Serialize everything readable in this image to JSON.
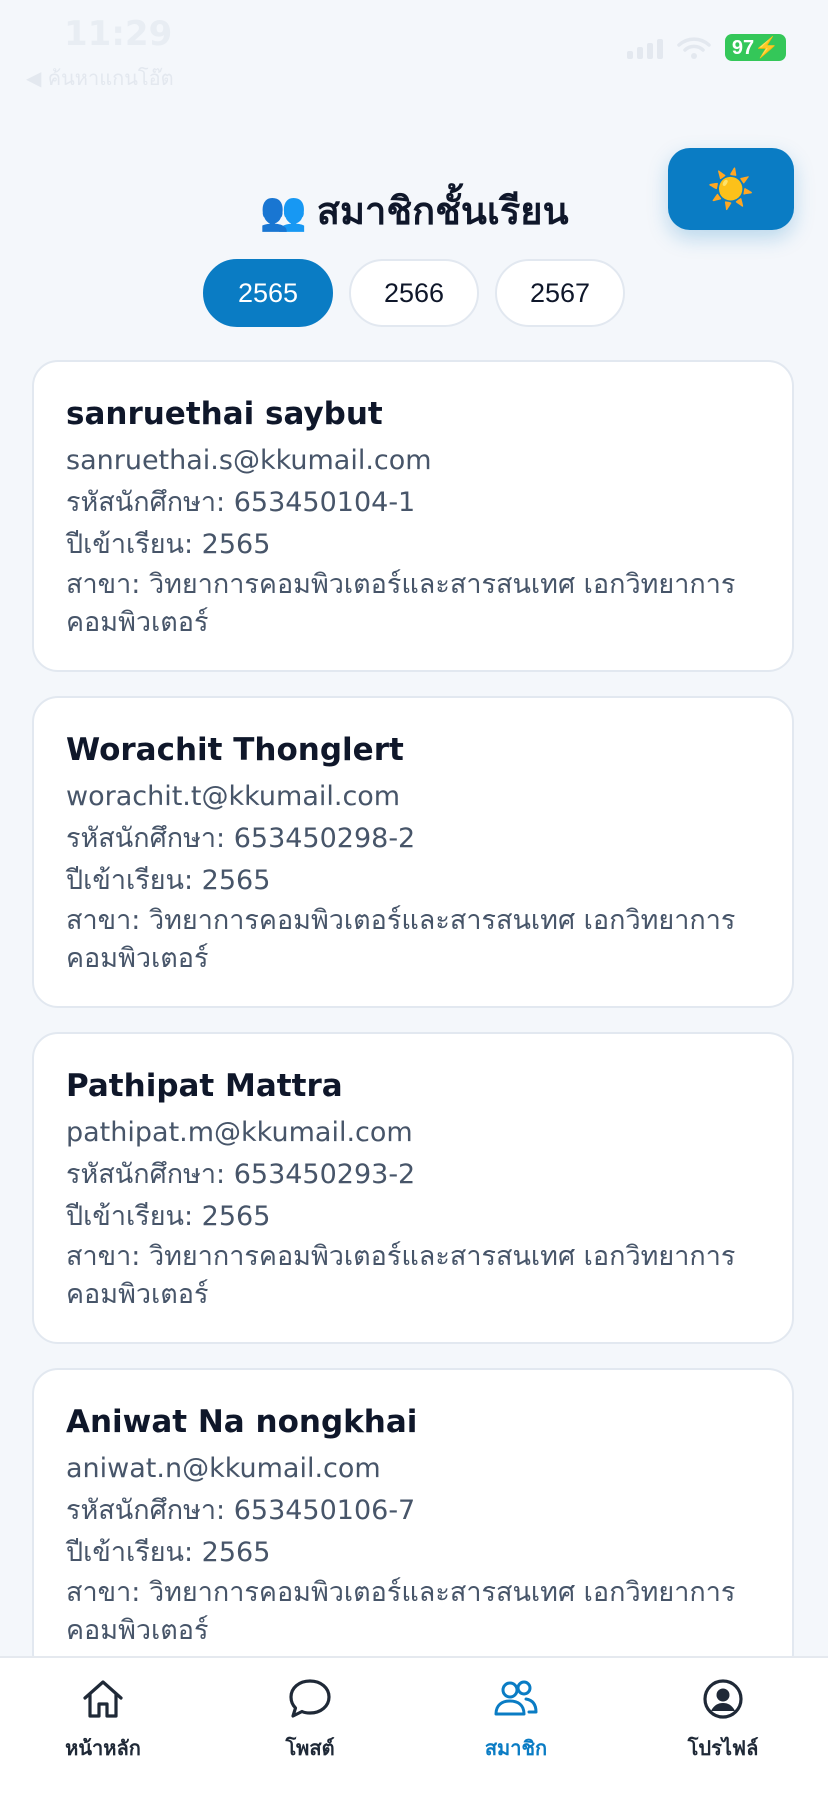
{
  "status_bar": {
    "time": "11:29",
    "back_app": "◀ ค้นหาแกนโอ๊ต",
    "battery": "97"
  },
  "header": {
    "title_icon": "👥",
    "title": "สมาชิกชั้นเรียน",
    "theme_toggle_icon": "☀️"
  },
  "year_tabs": [
    {
      "label": "2565",
      "active": true
    },
    {
      "label": "2566",
      "active": false
    },
    {
      "label": "2567",
      "active": false
    }
  ],
  "members": [
    {
      "name": "sanruethai saybut",
      "email": "sanruethai.s@kkumail.com",
      "student_id": "รหัสนักศึกษา: 653450104-1",
      "entry_year": "ปีเข้าเรียน: 2565",
      "major_line1": "สาขา: วิทยาการคอมพิวเตอร์และสารสนเทศ เอกวิทยาการ",
      "major_line2": "คอมพิวเตอร์"
    },
    {
      "name": "Worachit Thonglert",
      "email": "worachit.t@kkumail.com",
      "student_id": "รหัสนักศึกษา: 653450298-2",
      "entry_year": "ปีเข้าเรียน: 2565",
      "major_line1": "สาขา: วิทยาการคอมพิวเตอร์และสารสนเทศ เอกวิทยาการ",
      "major_line2": "คอมพิวเตอร์"
    },
    {
      "name": "Pathipat Mattra",
      "email": "pathipat.m@kkumail.com",
      "student_id": "รหัสนักศึกษา: 653450293-2",
      "entry_year": "ปีเข้าเรียน: 2565",
      "major_line1": "สาขา: วิทยาการคอมพิวเตอร์และสารสนเทศ เอกวิทยาการ",
      "major_line2": "คอมพิวเตอร์"
    },
    {
      "name": "Aniwat Na nongkhai",
      "email": "aniwat.n@kkumail.com",
      "student_id": "รหัสนักศึกษา: 653450106-7",
      "entry_year": "ปีเข้าเรียน: 2565",
      "major_line1": "สาขา: วิทยาการคอมพิวเตอร์และสารสนเทศ เอกวิทยาการ",
      "major_line2": "คอมพิวเตอร์"
    }
  ],
  "bottom_nav": [
    {
      "label": "หน้าหลัก",
      "icon": "home-icon",
      "active": false
    },
    {
      "label": "โพสต์",
      "icon": "chat-icon",
      "active": false
    },
    {
      "label": "สมาชิก",
      "icon": "people-icon",
      "active": true
    },
    {
      "label": "โปรไฟล์",
      "icon": "profile-icon",
      "active": false
    }
  ],
  "colors": {
    "accent": "#0a7cc4",
    "background": "#f4f7fb",
    "battery": "#34c759"
  }
}
